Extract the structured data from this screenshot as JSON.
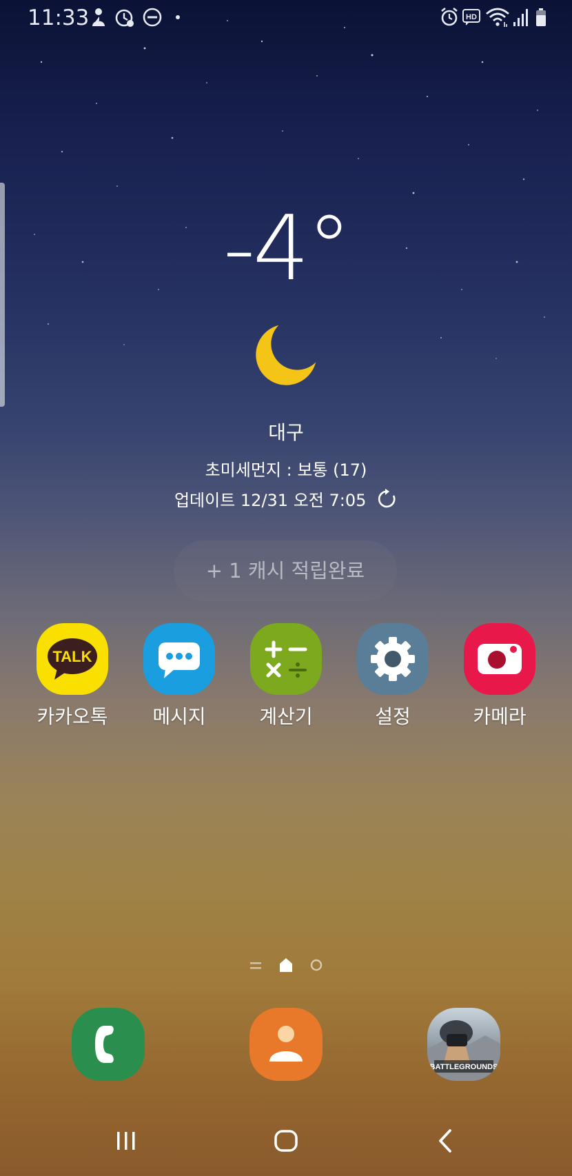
{
  "status_bar": {
    "time": "11:33",
    "left_icons": [
      "person-notification-icon",
      "alarm-sync-icon",
      "do-not-disturb-icon",
      "dot-icon"
    ],
    "right_icons": [
      "alarm-icon",
      "hd-icon",
      "wifi-icon",
      "signal-icon",
      "battery-icon"
    ]
  },
  "weather": {
    "temperature": "-4°",
    "condition_icon": "moon-icon",
    "city": "대구",
    "fine_dust": "초미세먼지 : 보통 (17)",
    "updated": "업데이트 12/31 오전 7:05"
  },
  "cash_pill": {
    "label": "+ 1 캐시 적립완료"
  },
  "apps": [
    {
      "label": "카카오톡",
      "icon": "kakaotalk-icon",
      "color": "#f9e000",
      "badge_text": "TALK"
    },
    {
      "label": "메시지",
      "icon": "messages-icon",
      "color": "#1a9ee0"
    },
    {
      "label": "계산기",
      "icon": "calculator-icon",
      "color": "#7da91e"
    },
    {
      "label": "설정",
      "icon": "settings-icon",
      "color": "#5b7e98"
    },
    {
      "label": "카메라",
      "icon": "camera-icon",
      "color": "#e8184a"
    }
  ],
  "page_indicator": {
    "pages": [
      "list-icon",
      "home-icon",
      "circle-icon"
    ],
    "active_index": 1
  },
  "dock": [
    {
      "icon": "phone-icon",
      "color": "#2a8f4e"
    },
    {
      "icon": "contacts-icon",
      "color": "#e8782a"
    },
    {
      "icon": "pubg-mobile-icon",
      "logo_text": "BATTLEGROUNDS"
    }
  ],
  "nav_bar": [
    "recent-apps-icon",
    "home-button-icon",
    "back-icon"
  ]
}
